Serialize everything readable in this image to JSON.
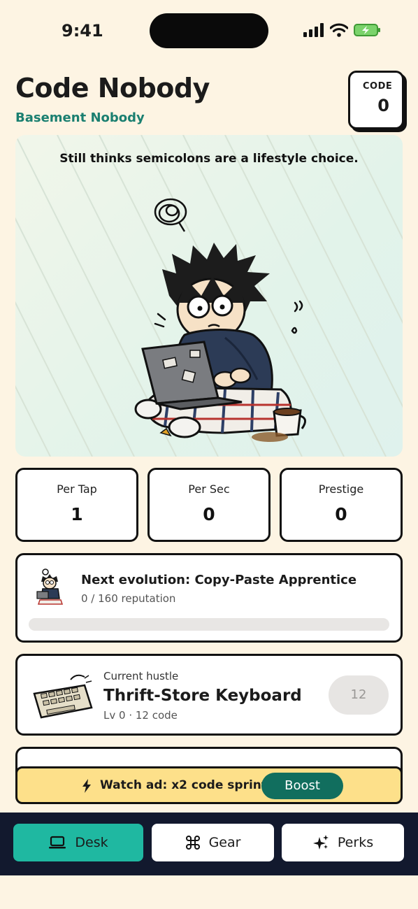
{
  "status": {
    "time": "9:41"
  },
  "header": {
    "title": "Code Nobody",
    "subtitle": "Basement Nobody"
  },
  "code_counter": {
    "label": "CODE",
    "value": "0"
  },
  "hero": {
    "quote": "Still thinks semicolons are a lifestyle choice."
  },
  "stats": [
    {
      "label": "Per Tap",
      "value": "1"
    },
    {
      "label": "Per Sec",
      "value": "0"
    },
    {
      "label": "Prestige",
      "value": "0"
    }
  ],
  "evolution": {
    "title": "Next evolution: Copy-Paste Apprentice",
    "progress_text": "0 / 160 reputation",
    "progress_fraction": 0
  },
  "hustle": {
    "label": "Current hustle",
    "name": "Thrift-Store Keyboard",
    "level": "Lv 0 · 12 code",
    "cost": "12"
  },
  "ad": {
    "text": "Watch ad: x2 code sprint",
    "button": "Boost"
  },
  "tabs": [
    {
      "label": "Desk",
      "icon": "laptop-icon",
      "active": true
    },
    {
      "label": "Gear",
      "icon": "command-icon",
      "active": false
    },
    {
      "label": "Perks",
      "icon": "sparkles-icon",
      "active": false
    }
  ],
  "colors": {
    "background": "#fdf4e3",
    "accent": "#1fb8a1",
    "subtitle": "#1a7f70",
    "ad_banner": "#fde08a",
    "boost": "#116e5e",
    "tabbar": "#12192e"
  }
}
